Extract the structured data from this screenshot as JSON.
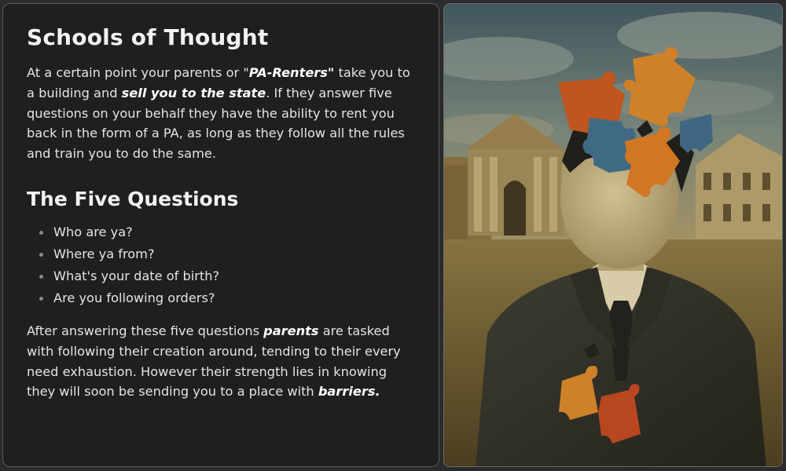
{
  "card": {
    "title": "Schools of Thought",
    "intro": {
      "t1": "At a certain point your parents or \"",
      "t2": "PA-Renters\"",
      "t3": " take you to a building and ",
      "t4": "sell you to the state",
      "t5": ". If they answer five questions on your behalf they have the ability to rent you back in the form of a PA, as long as they follow all the rules and train you to do the same."
    },
    "subtitle": "The Five Questions",
    "questions": [
      "Who are ya?",
      "Where ya from?",
      "What's your date of birth?",
      "Are you following orders?"
    ],
    "outro": {
      "t1": "After answering these five questions ",
      "t2": "parents",
      "t3": " are tasked with following their creation around, tending to their every need exhaustion. However their strength lies in knowing they will soon be sending you to a place with ",
      "t4": "barriers."
    }
  },
  "artwork": {
    "subject": "faceless man in suit with puzzle pieces for head, classical building background",
    "colors": {
      "sky": "#4f6a78",
      "ground": "#6b5a32",
      "suit": "#2f3029",
      "face": "#c9b78a",
      "puzzle_orange": "#d9862a",
      "puzzle_red": "#b8411f",
      "puzzle_blue": "#3e6d8c"
    }
  }
}
